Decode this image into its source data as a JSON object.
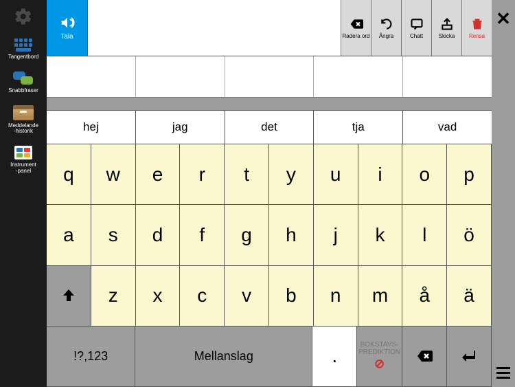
{
  "nav": {
    "items": [
      {
        "label": "Tangentbord"
      },
      {
        "label": "Snabbfraser"
      },
      {
        "label": "Meddelande\n-historik"
      },
      {
        "label": "Instrument\n-panel"
      }
    ]
  },
  "top": {
    "speak_label": "Tala",
    "actions": [
      {
        "label": "Radera ord"
      },
      {
        "label": "Ångra"
      },
      {
        "label": "Chatt"
      },
      {
        "label": "Skicka"
      },
      {
        "label": "Rensa"
      }
    ]
  },
  "predictions": [
    "hej",
    "jag",
    "det",
    "tja",
    "vad"
  ],
  "keyboard": {
    "row1": [
      "q",
      "w",
      "e",
      "r",
      "t",
      "y",
      "u",
      "i",
      "o",
      "p"
    ],
    "row2": [
      "a",
      "s",
      "d",
      "f",
      "g",
      "h",
      "j",
      "k",
      "l",
      "ö"
    ],
    "row3_keys": [
      "z",
      "x",
      "c",
      "v",
      "b",
      "n",
      "m",
      "å",
      "ä"
    ],
    "bottom": {
      "symbols": "!?,123",
      "space": "Mellanslag",
      "period": ".",
      "disabled": "BOKSTAVS-\nPREDIKTION"
    }
  }
}
